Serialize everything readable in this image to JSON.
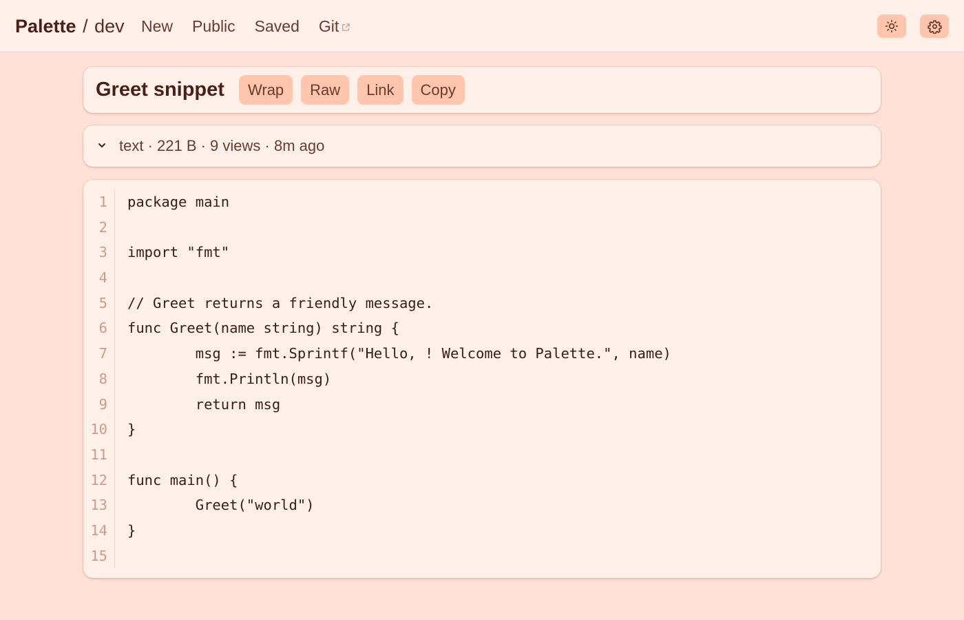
{
  "header": {
    "brand": "Palette",
    "separator": "/",
    "sub": "dev",
    "nav": [
      "New",
      "Public",
      "Saved",
      "Git"
    ]
  },
  "snippet": {
    "title": "Greet snippet",
    "actions": [
      "Wrap",
      "Raw",
      "Link",
      "Copy"
    ],
    "meta": "text · 221 B · 9 views · 8m ago"
  },
  "code": {
    "lines": [
      "package main",
      "",
      "import \"fmt\"",
      "",
      "// Greet returns a friendly message.",
      "func Greet(name string) string {",
      "        msg := fmt.Sprintf(\"Hello, ! Welcome to Palette.\", name)",
      "        fmt.Println(msg)",
      "        return msg",
      "}",
      "",
      "func main() {",
      "        Greet(\"world\")",
      "}",
      ""
    ]
  },
  "icons": {
    "theme_toggle": "sun-icon",
    "settings": "gear-icon",
    "external_link": "external-link-icon",
    "collapse": "chevron-down-icon"
  },
  "colors": {
    "background": "#ffe1d8",
    "surface": "#fff0ea",
    "accent": "#ffc6ad",
    "text": "#4a1f17"
  }
}
